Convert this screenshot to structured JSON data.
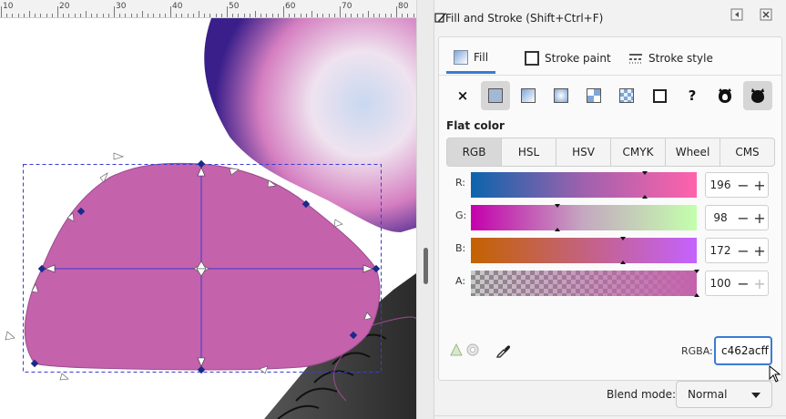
{
  "colors": {
    "fill": "#c462ac",
    "accent": "#3a7bd5",
    "selection": "#3b3bd5"
  },
  "ruler": {
    "labels": [
      "10",
      "20",
      "30",
      "40",
      "50",
      "60",
      "70",
      "80"
    ]
  },
  "panel": {
    "title": "Fill and Stroke (Shift+Ctrl+F)",
    "icons": {
      "title": "fill-stroke-icon",
      "left": "dock-left-icon",
      "close": "close-icon"
    }
  },
  "tabs": [
    {
      "label": "Fill",
      "icon": "fill-gradient-icon",
      "active": true
    },
    {
      "label": "Stroke paint",
      "icon": "stroke-paint-icon",
      "active": false
    },
    {
      "label": "Stroke style",
      "icon": "stroke-style-icon",
      "active": false
    }
  ],
  "paint_types": [
    {
      "name": "no-paint",
      "glyph": "×"
    },
    {
      "name": "flat-color",
      "selected": true
    },
    {
      "name": "linear-gradient"
    },
    {
      "name": "radial-gradient"
    },
    {
      "name": "pattern"
    },
    {
      "name": "mesh-gradient"
    },
    {
      "name": "swatch"
    },
    {
      "name": "unset",
      "glyph": "?"
    },
    {
      "name": "fill-rule-evenodd"
    },
    {
      "name": "fill-rule-nonzero",
      "selected": true
    }
  ],
  "flat_color_label": "Flat color",
  "modes": [
    "RGB",
    "HSL",
    "HSV",
    "CMYK",
    "Wheel",
    "CMS"
  ],
  "active_mode": "RGB",
  "sliders": [
    {
      "label": "R:",
      "value": "196",
      "fraction": 0.769
    },
    {
      "label": "G:",
      "value": "98",
      "fraction": 0.384
    },
    {
      "label": "B:",
      "value": "172",
      "fraction": 0.675
    },
    {
      "label": "A:",
      "value": "100",
      "fraction": 1.0
    }
  ],
  "rgba": {
    "label": "RGBA:",
    "value": "c462acff"
  },
  "blend": {
    "label": "Blend mode:",
    "value": "Normal"
  }
}
